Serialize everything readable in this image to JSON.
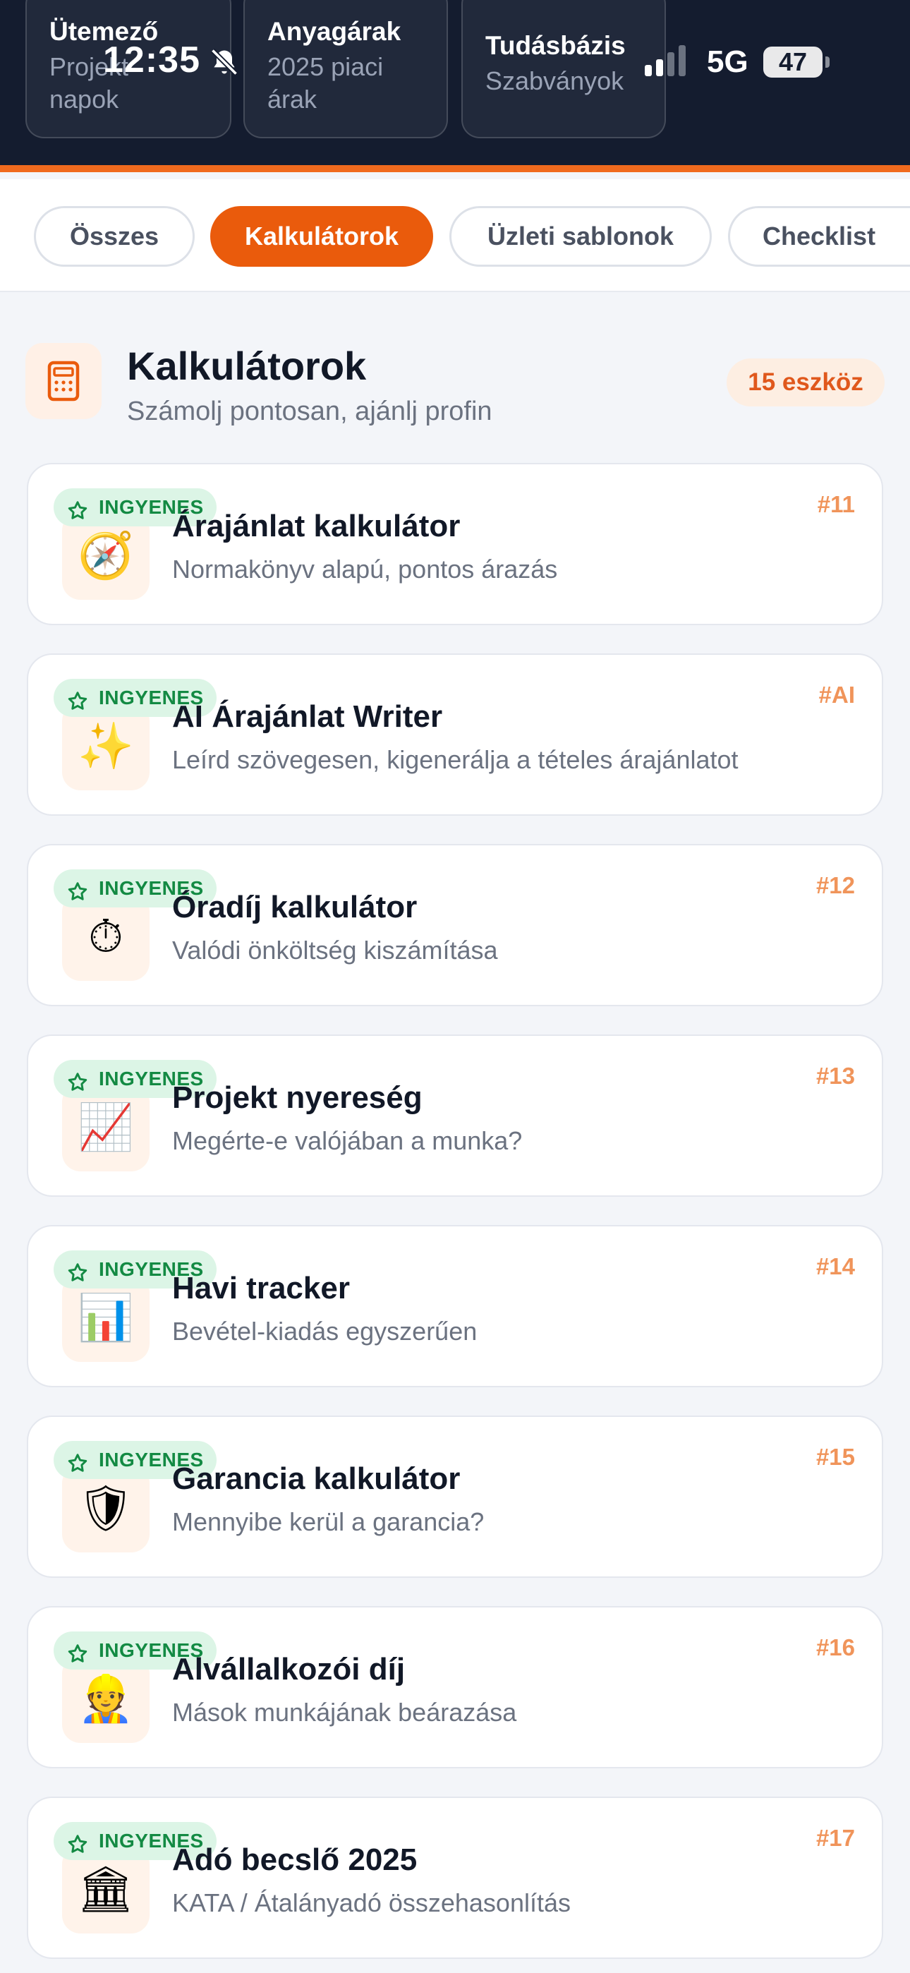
{
  "status_bar": {
    "time": "12:35",
    "network": "5G",
    "battery": "47"
  },
  "quick_cards": [
    {
      "title": "Ütemező",
      "sub_line1": "Projekt",
      "sub_line2": "napok"
    },
    {
      "title": "Anyagárak",
      "sub_line1": "2025 piaci",
      "sub_line2": "árak"
    },
    {
      "title": "Tudásbázis",
      "sub_line1": "Szabványok",
      "sub_line2": ""
    }
  ],
  "filters": [
    "Összes",
    "Kalkulátorok",
    "Üzleti sablonok",
    "Checklist"
  ],
  "active_filter": "Kalkulátorok",
  "section": {
    "title": "Kalkulátorok",
    "subtitle": "Számolj pontosan, ajánlj profin",
    "count": "15 eszköz"
  },
  "badge_label": "INGYENES",
  "tools": [
    {
      "title": "Árajánlat kalkulátor",
      "desc": "Normakönyv alapú, pontos árazás",
      "num": "#11",
      "icon": "compass-icon",
      "glyph": "🧭"
    },
    {
      "title": "AI Árajánlat Writer",
      "desc": "Leírd szövegesen, kigenerálja a tételes árajánlatot",
      "num": "#AI",
      "icon": "sparkles-icon",
      "glyph": "✨"
    },
    {
      "title": "Óradíj kalkulátor",
      "desc": "Valódi önköltség kiszámítása",
      "num": "#12",
      "icon": "stopwatch-icon",
      "glyph": "⏱"
    },
    {
      "title": "Projekt nyereség",
      "desc": "Megérte-e valójában a munka?",
      "num": "#13",
      "icon": "trend-chart-icon",
      "glyph": "📈"
    },
    {
      "title": "Havi tracker",
      "desc": "Bevétel-kiadás egyszerűen",
      "num": "#14",
      "icon": "bar-chart-icon",
      "glyph": "📊"
    },
    {
      "title": "Garancia kalkulátor",
      "desc": "Mennyibe kerül a garancia?",
      "num": "#15",
      "icon": "shield-icon",
      "glyph": "🛡"
    },
    {
      "title": "Alvállalkozói díj",
      "desc": "Mások munkájának beárazása",
      "num": "#16",
      "icon": "construction-worker-icon",
      "glyph": "👷"
    },
    {
      "title": "Adó becslő 2025",
      "desc": "KATA / Átalányadó összehasonlítás",
      "num": "#17",
      "icon": "classical-building-icon",
      "glyph": "🏛"
    }
  ],
  "colors": {
    "accent": "#ea5b0c",
    "header_bg": "#141c2f",
    "free_badge_bg": "#dcf5e6",
    "free_badge_text": "#138a43",
    "tool_number": "#f0945a"
  }
}
